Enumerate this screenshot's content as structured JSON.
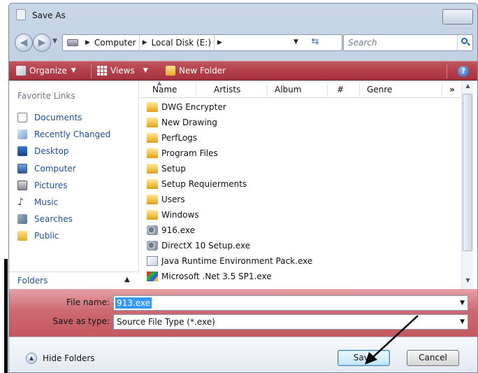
{
  "window": {
    "title": "Save As"
  },
  "address": {
    "crumbs": [
      "Computer",
      "Local Disk (E:)"
    ],
    "search_placeholder": "Search"
  },
  "toolbar": {
    "organize": "Organize",
    "views": "Views",
    "new_folder": "New Folder"
  },
  "favorites": {
    "header": "Favorite Links",
    "items": [
      "Documents",
      "Recently Changed",
      "Desktop",
      "Computer",
      "Pictures",
      "Music",
      "Searches",
      "Public"
    ],
    "folders_label": "Folders"
  },
  "columns": [
    "Name",
    "Artists",
    "Album",
    "#",
    "Genre"
  ],
  "files": [
    {
      "name": "DWG Encrypter",
      "type": "folder"
    },
    {
      "name": "New Drawing",
      "type": "folder"
    },
    {
      "name": "PerfLogs",
      "type": "folder"
    },
    {
      "name": "Program Files",
      "type": "folder"
    },
    {
      "name": "Setup",
      "type": "folder"
    },
    {
      "name": "Setup Requierments",
      "type": "folder"
    },
    {
      "name": "Users",
      "type": "folder"
    },
    {
      "name": "Windows",
      "type": "folder"
    },
    {
      "name": "916.exe",
      "type": "exe-gear"
    },
    {
      "name": "DirectX 10 Setup.exe",
      "type": "exe-gear"
    },
    {
      "name": "Java Runtime Environment Pack.exe",
      "type": "exe-java"
    },
    {
      "name": "Microsoft .Net 3.5 SP1.exe",
      "type": "exe-ms"
    }
  ],
  "fields": {
    "file_name_label": "File name:",
    "file_name_value": "913.exe",
    "save_type_label": "Save as type:",
    "save_type_value": "Source File Type  (*.exe)"
  },
  "footer": {
    "hide_folders": "Hide Folders",
    "save": "Save",
    "cancel": "Cancel"
  },
  "colors": {
    "toolbar": "#b3404b",
    "link": "#1e4f9c",
    "selection": "#3399ff"
  }
}
